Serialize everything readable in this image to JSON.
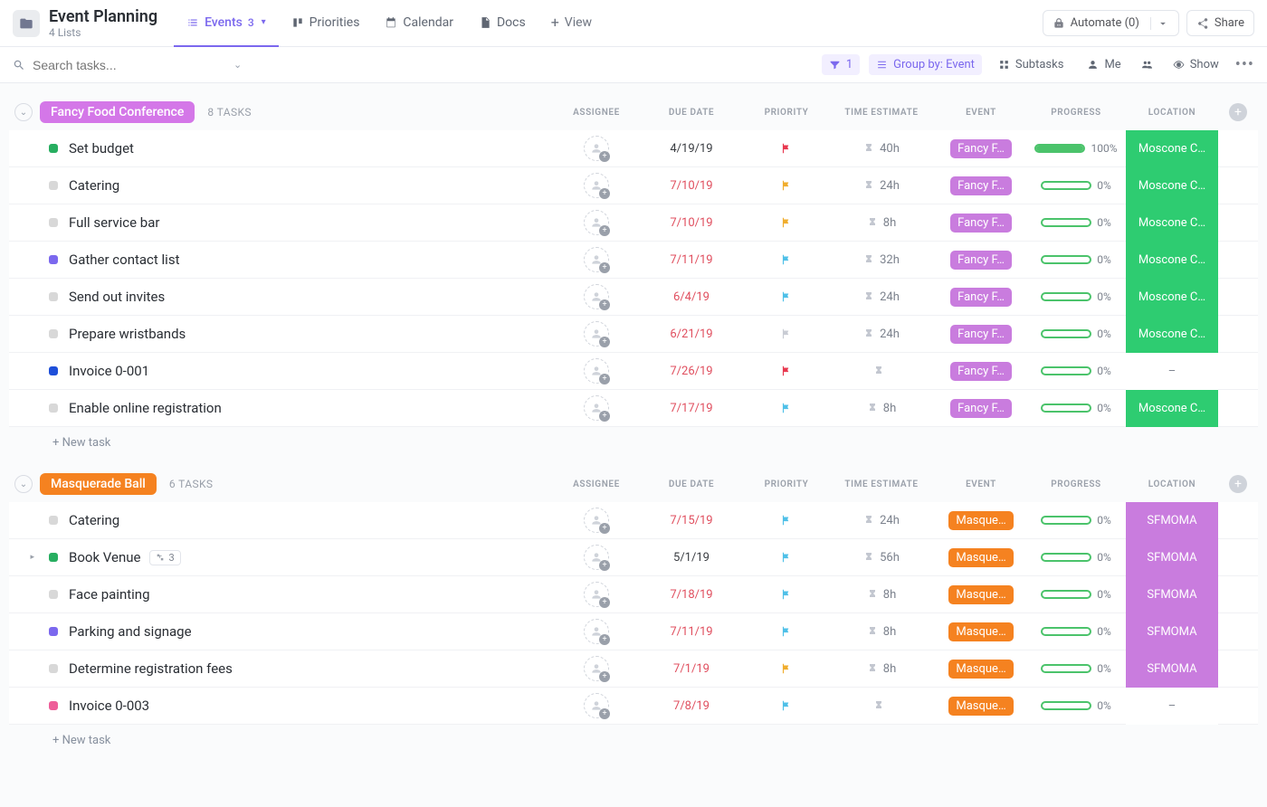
{
  "header": {
    "title": "Event Planning",
    "subtitle": "4 Lists",
    "tabs": [
      {
        "label": "Events",
        "count": "3",
        "active": true,
        "icon": "list"
      },
      {
        "label": "Priorities",
        "icon": "board"
      },
      {
        "label": "Calendar",
        "icon": "calendar"
      },
      {
        "label": "Docs",
        "icon": "doc"
      }
    ],
    "add_view": "View",
    "automate": "Automate (0)",
    "share": "Share"
  },
  "toolbar": {
    "search_placeholder": "Search tasks...",
    "filter_count": "1",
    "groupby": "Group by: Event",
    "subtasks": "Subtasks",
    "me": "Me",
    "show": "Show"
  },
  "columns": [
    "ASSIGNEE",
    "DUE DATE",
    "PRIORITY",
    "TIME ESTIMATE",
    "EVENT",
    "PROGRESS",
    "LOCATION"
  ],
  "new_task_label": "+ New task",
  "colors": {
    "status": {
      "green": "#27ae60",
      "gray": "#d8d8d8",
      "purple": "#7b68ee",
      "blue": "#1e4fd9",
      "pink": "#ee5e99"
    },
    "flag": {
      "red": "#e8384f",
      "yellow": "#f0ad2d",
      "blue": "#4fc0e8",
      "gray": "#c9ccd4"
    },
    "event": {
      "fancy": "#c97cde",
      "masquerade": "#f58220"
    },
    "location": {
      "moscone": "#2ecc71",
      "sfmoma": "#c97cde",
      "none": "#ffffff"
    }
  },
  "groups": [
    {
      "name": "Fancy Food Conference",
      "pill_color": "#d477e8",
      "task_count": "8 TASKS",
      "event_key": "fancy",
      "event_text": "Fancy F…",
      "tasks": [
        {
          "title": "Set budget",
          "status": "green",
          "due": "4/19/19",
          "overdue": false,
          "flag": "red",
          "time": "40h",
          "progress": 100,
          "loc": "Moscone C…",
          "loc_key": "moscone"
        },
        {
          "title": "Catering",
          "status": "gray",
          "due": "7/10/19",
          "overdue": true,
          "flag": "yellow",
          "time": "24h",
          "progress": 0,
          "loc": "Moscone C…",
          "loc_key": "moscone"
        },
        {
          "title": "Full service bar",
          "status": "gray",
          "due": "7/10/19",
          "overdue": true,
          "flag": "yellow",
          "time": "8h",
          "progress": 0,
          "loc": "Moscone C…",
          "loc_key": "moscone"
        },
        {
          "title": "Gather contact list",
          "status": "purple",
          "due": "7/11/19",
          "overdue": true,
          "flag": "blue",
          "time": "32h",
          "progress": 0,
          "loc": "Moscone C…",
          "loc_key": "moscone"
        },
        {
          "title": "Send out invites",
          "status": "gray",
          "due": "6/4/19",
          "overdue": true,
          "flag": "blue",
          "time": "24h",
          "progress": 0,
          "loc": "Moscone C…",
          "loc_key": "moscone"
        },
        {
          "title": "Prepare wristbands",
          "status": "gray",
          "due": "6/21/19",
          "overdue": true,
          "flag": "gray",
          "time": "24h",
          "progress": 0,
          "loc": "Moscone C…",
          "loc_key": "moscone"
        },
        {
          "title": "Invoice 0-001",
          "status": "blue",
          "due": "7/26/19",
          "overdue": true,
          "flag": "red",
          "time": "",
          "progress": 0,
          "loc": "–",
          "loc_key": "none"
        },
        {
          "title": "Enable online registration",
          "status": "gray",
          "due": "7/17/19",
          "overdue": true,
          "flag": "blue",
          "time": "8h",
          "progress": 0,
          "loc": "Moscone C…",
          "loc_key": "moscone"
        }
      ]
    },
    {
      "name": "Masquerade Ball",
      "pill_color": "#f58220",
      "task_count": "6 TASKS",
      "event_key": "masquerade",
      "event_text": "Masque…",
      "tasks": [
        {
          "title": "Catering",
          "status": "gray",
          "due": "7/15/19",
          "overdue": true,
          "flag": "blue",
          "time": "24h",
          "progress": 0,
          "loc": "SFMOMA",
          "loc_key": "sfmoma"
        },
        {
          "title": "Book Venue",
          "status": "green",
          "due": "5/1/19",
          "overdue": false,
          "flag": "blue",
          "time": "56h",
          "progress": 0,
          "loc": "SFMOMA",
          "loc_key": "sfmoma",
          "subtasks": "3",
          "expand": true
        },
        {
          "title": "Face painting",
          "status": "gray",
          "due": "7/18/19",
          "overdue": true,
          "flag": "blue",
          "time": "8h",
          "progress": 0,
          "loc": "SFMOMA",
          "loc_key": "sfmoma"
        },
        {
          "title": "Parking and signage",
          "status": "purple",
          "due": "7/11/19",
          "overdue": true,
          "flag": "blue",
          "time": "8h",
          "progress": 0,
          "loc": "SFMOMA",
          "loc_key": "sfmoma"
        },
        {
          "title": "Determine registration fees",
          "status": "gray",
          "due": "7/1/19",
          "overdue": true,
          "flag": "yellow",
          "time": "8h",
          "progress": 0,
          "loc": "SFMOMA",
          "loc_key": "sfmoma"
        },
        {
          "title": "Invoice 0-003",
          "status": "pink",
          "due": "7/8/19",
          "overdue": true,
          "flag": "blue",
          "time": "",
          "progress": 0,
          "loc": "–",
          "loc_key": "none"
        }
      ]
    }
  ]
}
